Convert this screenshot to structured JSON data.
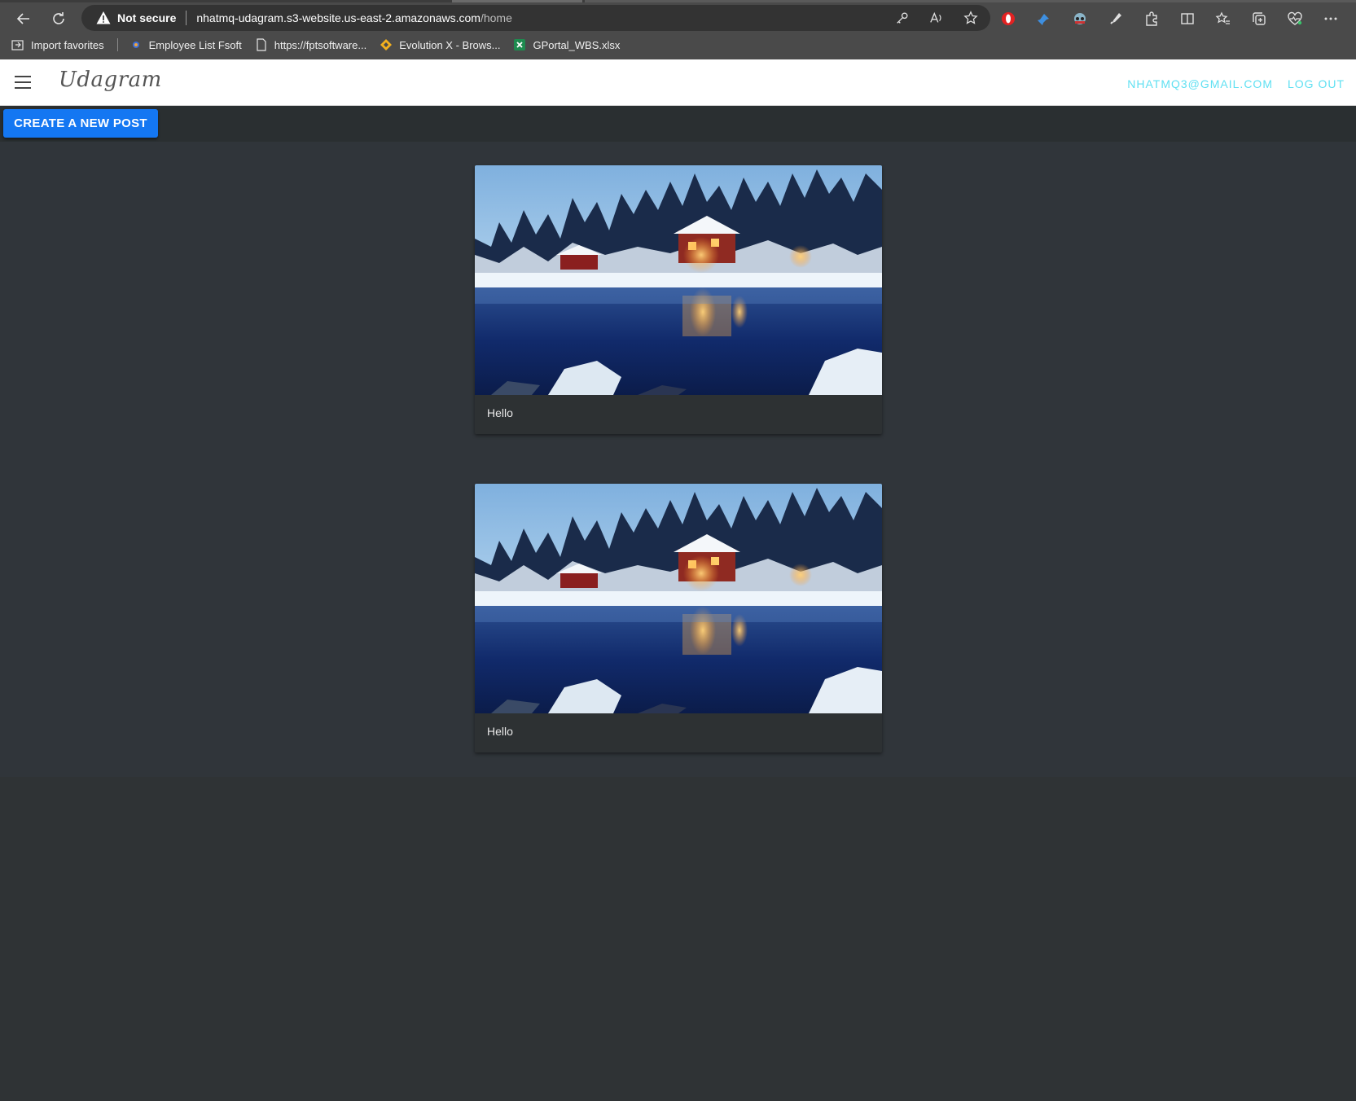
{
  "browser": {
    "address": {
      "security_label": "Not secure",
      "url_host": "nhatmq-udagram.s3-website.us-east-2.amazonaws.com",
      "url_path": "/home"
    },
    "bookmarks": [
      {
        "label": "Import favorites",
        "icon": "import-icon"
      },
      {
        "label": "Employee List Fsoft",
        "icon": "site-icon"
      },
      {
        "label": "https://fptsoftware...",
        "icon": "page-icon"
      },
      {
        "label": "Evolution X - Brows...",
        "icon": "diamond-icon"
      },
      {
        "label": "GPortal_WBS.xlsx",
        "icon": "excel-icon"
      }
    ]
  },
  "header": {
    "title": "Udagram",
    "user_email": "NHATMQ3@GMAIL.COM",
    "logout_label": "LOG OUT"
  },
  "actions": {
    "create_post_label": "CREATE A NEW POST"
  },
  "feed": {
    "posts": [
      {
        "caption": "Hello",
        "image": "snowy lakeside cabin at dusk"
      },
      {
        "caption": "Hello",
        "image": "snowy lakeside cabin at dusk"
      }
    ]
  },
  "colors": {
    "accent_link": "#5fe0f2",
    "primary_button": "#1477f2",
    "page_background": "#2f3335"
  }
}
